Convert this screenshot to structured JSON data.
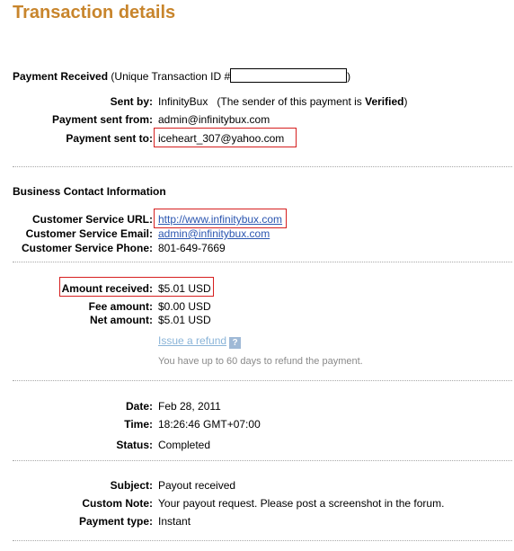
{
  "page": {
    "title": "Transaction details"
  },
  "payment": {
    "heading": "Payment Received",
    "id_prefix": "(Unique Transaction ID #",
    "id_suffix": ")",
    "sent_by_label": "Sent by:",
    "sent_by_value": "InfinityBux",
    "sender_note_prefix": "(The sender of this payment is ",
    "sender_note_status": "Verified",
    "sender_note_suffix": ")",
    "sent_from_label": "Payment sent from:",
    "sent_from_value": "admin@infinitybux.com",
    "sent_to_label": "Payment sent to:",
    "sent_to_value": "iceheart_307@yahoo.com"
  },
  "business": {
    "heading": "Business Contact Information",
    "url_label": "Customer Service URL:",
    "url_value": "http://www.infinitybux.com",
    "email_label": "Customer Service Email:",
    "email_value": "admin@infinitybux.com",
    "phone_label": "Customer Service Phone:",
    "phone_value": "801-649-7669"
  },
  "amounts": {
    "received_label": "Amount received:",
    "received_value": "$5.01 USD",
    "fee_label": "Fee amount:",
    "fee_value": "$0.00 USD",
    "net_label": "Net amount:",
    "net_value": "$5.01 USD",
    "refund_link": "Issue a refund",
    "help_icon": "?",
    "refund_note": "You have up to 60 days to refund the payment."
  },
  "details": {
    "date_label": "Date:",
    "date_value": "Feb 28, 2011",
    "time_label": "Time:",
    "time_value": "18:26:46 GMT+07:00",
    "status_label": "Status:",
    "status_value": "Completed"
  },
  "extra": {
    "subject_label": "Subject:",
    "subject_value": "Payout received",
    "note_label": "Custom Note:",
    "note_value": "Your payout request. Please post a screenshot in the forum.",
    "type_label": "Payment type:",
    "type_value": "Instant"
  },
  "colors": {
    "title": "#c8852c",
    "highlight_box": "#d61f1f",
    "link": "#2a55b0"
  }
}
